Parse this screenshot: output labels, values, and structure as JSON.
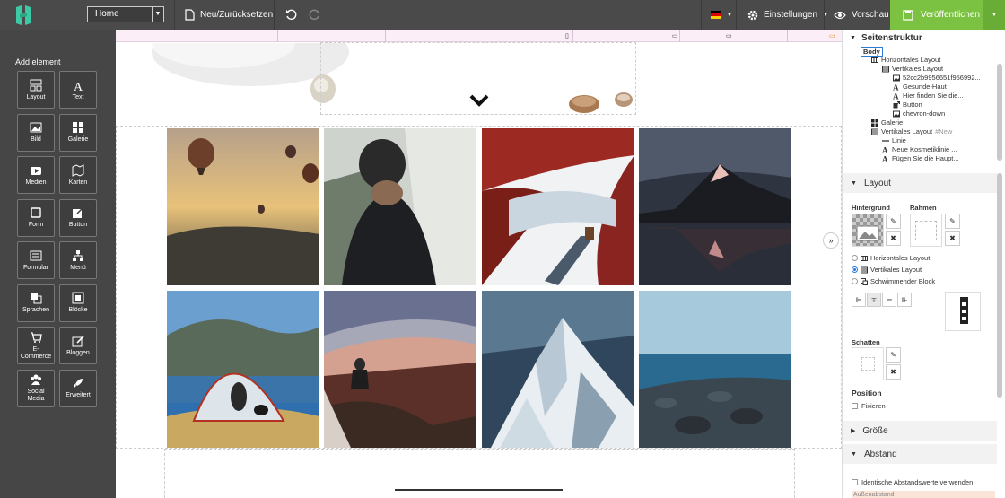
{
  "topbar": {
    "page_select": "Home",
    "new_reset": "Neu/Zurücksetzen",
    "settings": "Einstellungen",
    "preview": "Vorschau",
    "publish": "Veröffentlichen",
    "colors": {
      "bar": "#4a4a4a",
      "publish": "#7cc242",
      "logo": "#3cc9a4"
    }
  },
  "left_panel": {
    "title": "Add element",
    "elements": [
      {
        "label": "Layout",
        "icon": "layout-icon"
      },
      {
        "label": "Text",
        "icon": "text-icon"
      },
      {
        "label": "Bild",
        "icon": "image-icon"
      },
      {
        "label": "Galerie",
        "icon": "gallery-icon"
      },
      {
        "label": "Medien",
        "icon": "media-icon"
      },
      {
        "label": "Karten",
        "icon": "map-icon"
      },
      {
        "label": "Form",
        "icon": "form-icon"
      },
      {
        "label": "Button",
        "icon": "button-icon"
      },
      {
        "label": "Formular",
        "icon": "formular-icon"
      },
      {
        "label": "Menü",
        "icon": "menu-icon"
      },
      {
        "label": "Sprachen",
        "icon": "language-icon"
      },
      {
        "label": "Blöcke",
        "icon": "blocks-icon"
      },
      {
        "label": "E-\nCommerce",
        "icon": "cart-icon"
      },
      {
        "label": "Bloggen",
        "icon": "blog-icon"
      },
      {
        "label": "Social\nMedia",
        "icon": "social-icon"
      },
      {
        "label": "Erweitert",
        "icon": "rocket-icon"
      }
    ]
  },
  "structure": {
    "title": "Seitenstruktur",
    "items": [
      {
        "label": "Body",
        "level": 0,
        "icon": "none"
      },
      {
        "label": "Horizontales Layout",
        "level": 1,
        "icon": "hlayout-icon"
      },
      {
        "label": "Vertikales Layout",
        "level": 2,
        "icon": "vlayout-icon"
      },
      {
        "label": "52cc2b9956651f956992...",
        "level": 3,
        "icon": "image-icon"
      },
      {
        "label": "Gesunde-Haut",
        "level": 3,
        "icon": "text-icon"
      },
      {
        "label": "Hier finden Sie die...",
        "level": 3,
        "icon": "text-icon"
      },
      {
        "label": "Button",
        "level": 3,
        "icon": "button-icon"
      },
      {
        "label": "chevron-down",
        "level": 3,
        "icon": "image-icon"
      },
      {
        "label": "Galerie",
        "level": 1,
        "icon": "gallery-icon"
      },
      {
        "label": "Vertikales Layout",
        "level": 1,
        "icon": "vlayout-icon",
        "tag": "#New"
      },
      {
        "label": "Linie",
        "level": 2,
        "icon": "line-icon"
      },
      {
        "label": "Neue Kosmetiklinie ...",
        "level": 2,
        "icon": "text-icon"
      },
      {
        "label": "Fügen Sie die Haupt...",
        "level": 2,
        "icon": "text-icon"
      }
    ]
  },
  "layout_section": {
    "title": "Layout",
    "background_label": "Hintergrund",
    "frame_label": "Rahmen",
    "options": [
      "Horizontales Layout",
      "Vertikales Layout",
      "Schwimmender Block"
    ],
    "selected": "Vertikales Layout",
    "shadow_label": "Schatten",
    "position_label": "Position",
    "fix_label": "Fixieren"
  },
  "size_section": {
    "title": "Größe"
  },
  "spacing_section": {
    "title": "Abstand",
    "same_values": "Identische Abstandswerte verwenden",
    "outer": "Außenabstand"
  }
}
